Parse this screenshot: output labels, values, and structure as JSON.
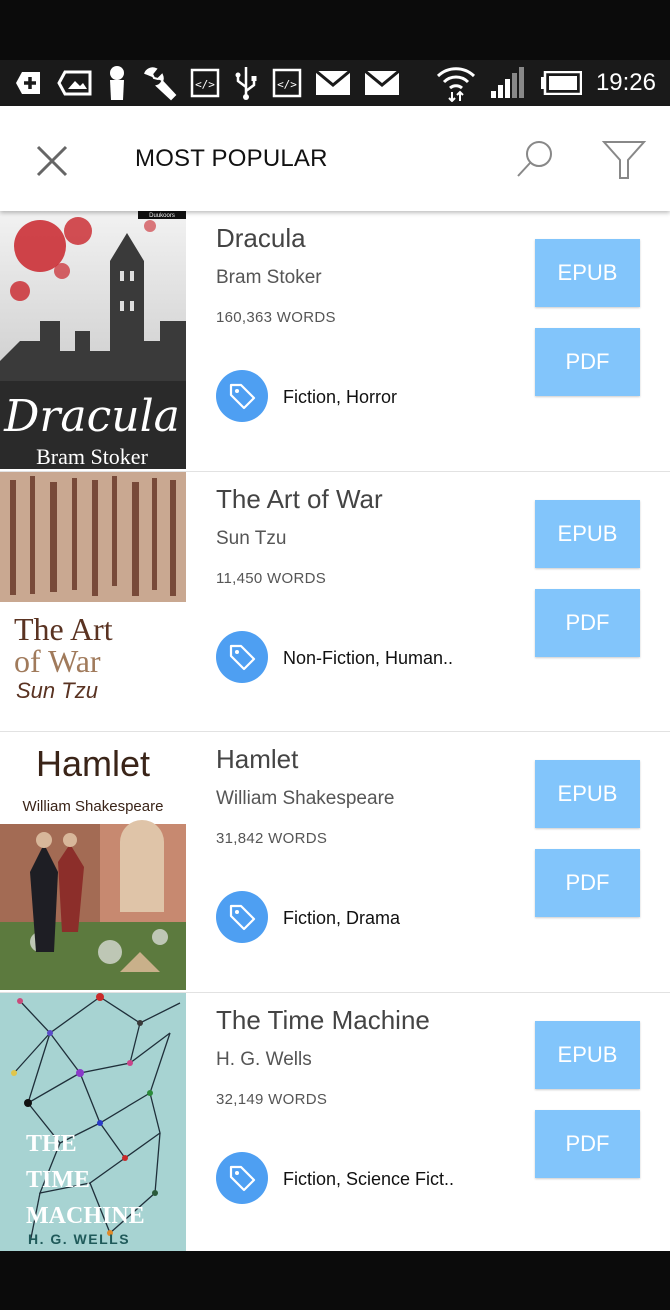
{
  "status_bar": {
    "time": "19:26",
    "icons": [
      "add-box-icon",
      "image-icon",
      "person-icon",
      "wrench-icon",
      "code-icon",
      "usb-icon",
      "code-icon",
      "mail-icon",
      "mail-icon",
      "wifi-icon",
      "signal-icon",
      "battery-icon"
    ]
  },
  "app_bar": {
    "title": "MOST POPULAR",
    "close_icon": "close-icon",
    "search_icon": "search-icon",
    "filter_icon": "filter-icon"
  },
  "books": [
    {
      "title": "Dracula",
      "author": "Bram Stoker",
      "words": "160,363 WORDS",
      "tags": "Fiction, Horror",
      "epub_label": "EPUB",
      "pdf_label": "PDF",
      "cover": {
        "title_text": "Dracula",
        "author_text": "Bram Stoker",
        "publisher_text": "Duukoors"
      }
    },
    {
      "title": "The Art of War",
      "author": "Sun Tzu",
      "words": "11,450 WORDS",
      "tags": "Non-Fiction, Human..",
      "epub_label": "EPUB",
      "pdf_label": "PDF",
      "cover": {
        "title_line1": "The Art",
        "title_line2": "of War",
        "author_text": "Sun Tzu"
      }
    },
    {
      "title": "Hamlet",
      "author": "William Shakespeare",
      "words": "31,842 WORDS",
      "tags": "Fiction, Drama",
      "epub_label": "EPUB",
      "pdf_label": "PDF",
      "cover": {
        "title_text": "Hamlet",
        "author_text": "William Shakespeare"
      }
    },
    {
      "title": "The Time Machine",
      "author": "H. G. Wells",
      "words": "32,149 WORDS",
      "tags": "Fiction, Science Fict..",
      "epub_label": "EPUB",
      "pdf_label": "PDF",
      "cover": {
        "title_line1": "THE",
        "title_line2": "TIME",
        "title_line3": "MACHINE",
        "author_text": "H. G. WELLS"
      }
    }
  ],
  "colors": {
    "button_bg": "#82c5fb",
    "tag_circle": "#4e9ff2",
    "status_bar": "#1a1a1a"
  }
}
